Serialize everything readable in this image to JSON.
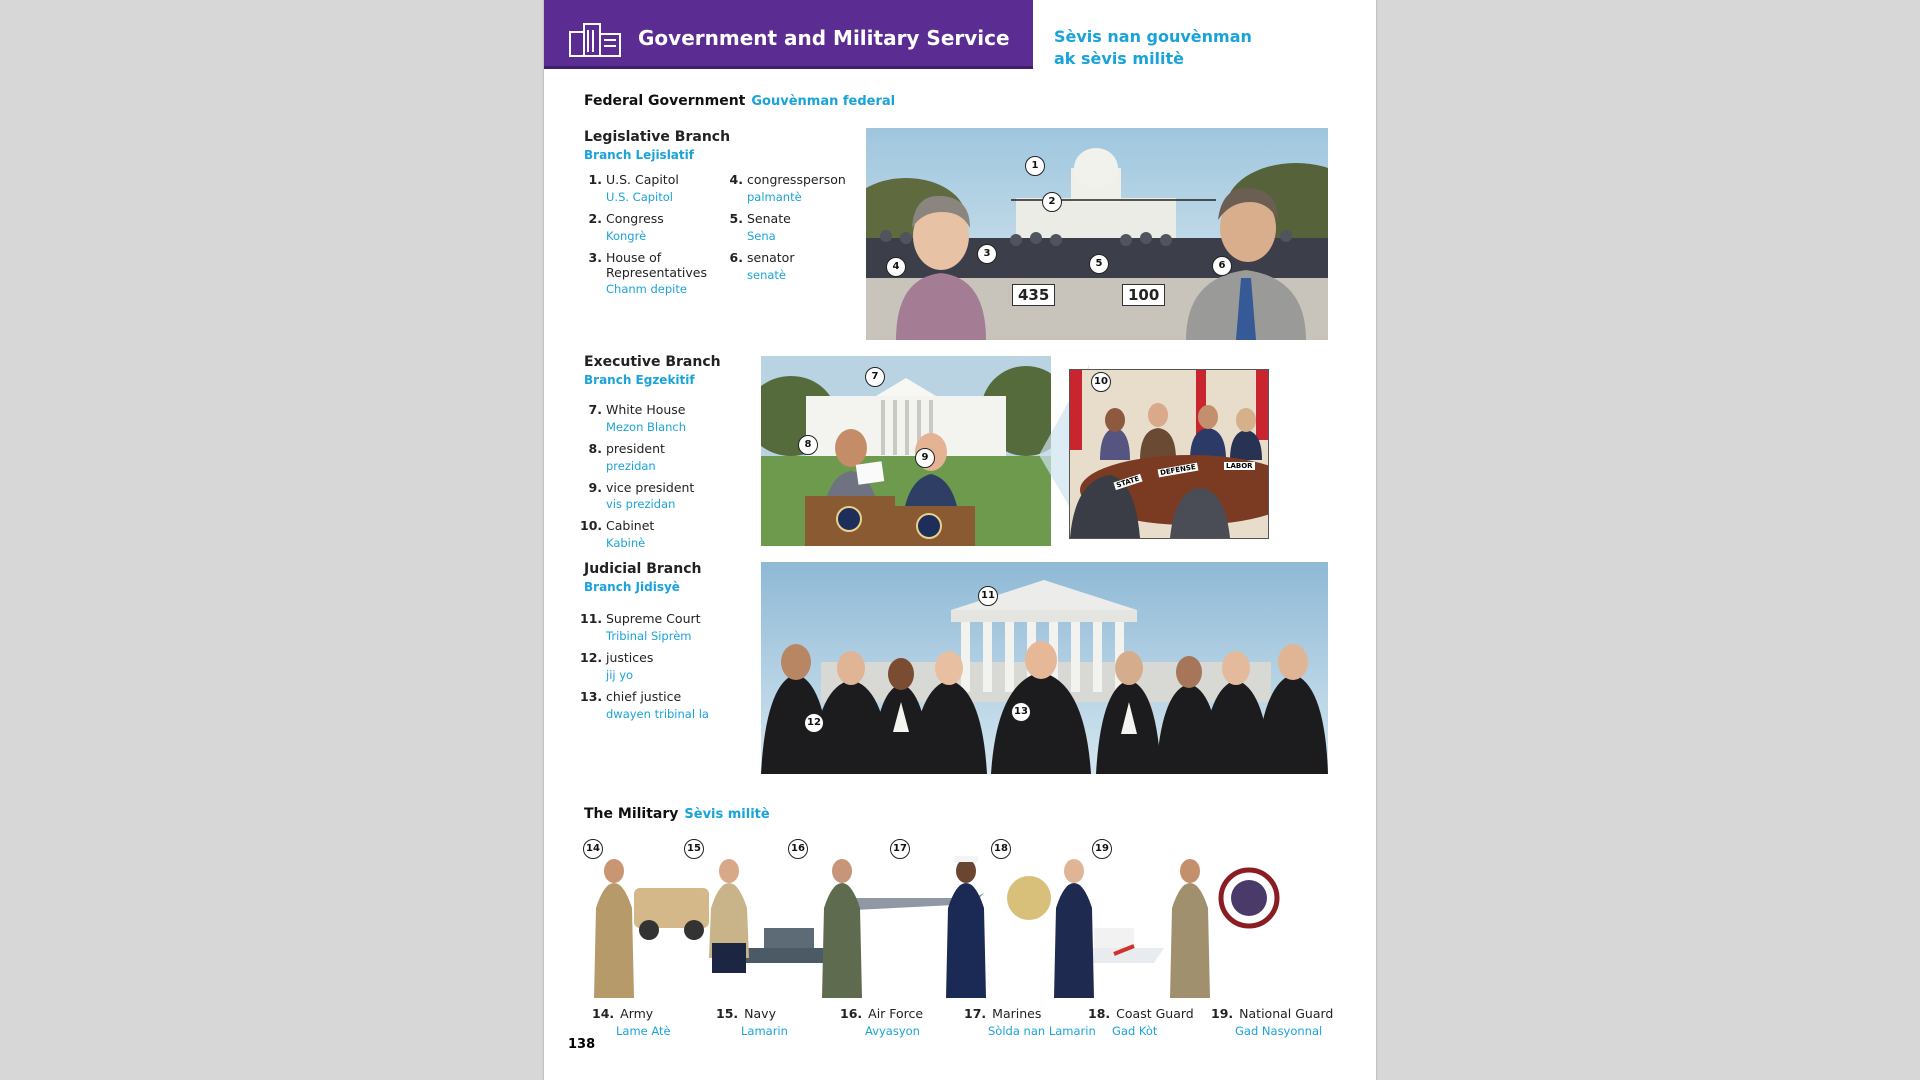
{
  "banner": {
    "title": "Government and Military Service",
    "icon": "government-buildings-icon"
  },
  "subtitle": "Sèvis nan gouvènman ak sèvis militè",
  "federal": {
    "en": "Federal Government",
    "ht": "Gouvènman federal"
  },
  "legislative": {
    "en": "Legislative Branch",
    "ht": "Branch Lejislatif",
    "items": [
      {
        "num": "1.",
        "en": "U.S. Capitol",
        "ht": "U.S. Capitol"
      },
      {
        "num": "2.",
        "en": "Congress",
        "ht": "Kongrè"
      },
      {
        "num": "3.",
        "en": "House of Representatives",
        "ht": "Chanm depite"
      },
      {
        "num": "4.",
        "en": "congressperson",
        "ht": "palmantè"
      },
      {
        "num": "5.",
        "en": "Senate",
        "ht": "Sena"
      },
      {
        "num": "6.",
        "en": "senator",
        "ht": "senatè"
      }
    ],
    "signs": [
      "435",
      "100"
    ]
  },
  "executive": {
    "en": "Executive Branch",
    "ht": "Branch Egzekitif",
    "items": [
      {
        "num": "7.",
        "en": "White House",
        "ht": "Mezon Blanch"
      },
      {
        "num": "8.",
        "en": "president",
        "ht": "prezidan"
      },
      {
        "num": "9.",
        "en": "vice president",
        "ht": "vis prezidan"
      },
      {
        "num": "10.",
        "en": "Cabinet",
        "ht": "Kabinè"
      }
    ],
    "placards": [
      "STATE",
      "DEFENSE",
      "LABOR"
    ]
  },
  "judicial": {
    "en": "Judicial Branch",
    "ht": "Branch Jidisyè",
    "items": [
      {
        "num": "11.",
        "en": "Supreme Court",
        "ht": "Tribinal Siprèm"
      },
      {
        "num": "12.",
        "en": "justices",
        "ht": "jij yo"
      },
      {
        "num": "13.",
        "en": "chief justice",
        "ht": "dwayen tribinal la"
      }
    ]
  },
  "military": {
    "en": "The Military",
    "ht": "Sèvis militè",
    "items": [
      {
        "num": "14.",
        "en": "Army",
        "ht": "Lame Atè"
      },
      {
        "num": "15.",
        "en": "Navy",
        "ht": "Lamarin"
      },
      {
        "num": "16.",
        "en": "Air Force",
        "ht": "Avyasyon"
      },
      {
        "num": "17.",
        "en": "Marines",
        "ht": "Sòlda nan Lamarin"
      },
      {
        "num": "18.",
        "en": "Coast Guard",
        "ht": "Gad Kòt"
      },
      {
        "num": "19.",
        "en": "National Guard",
        "ht": "Gad Nasyonnal"
      }
    ]
  },
  "callouts": [
    "1",
    "2",
    "3",
    "4",
    "5",
    "6",
    "7",
    "8",
    "9",
    "10",
    "11",
    "12",
    "13",
    "14",
    "15",
    "16",
    "17",
    "18",
    "19"
  ],
  "page_number": "138",
  "colors": {
    "banner": "#5b2c91",
    "accent": "#1aa3d9"
  }
}
